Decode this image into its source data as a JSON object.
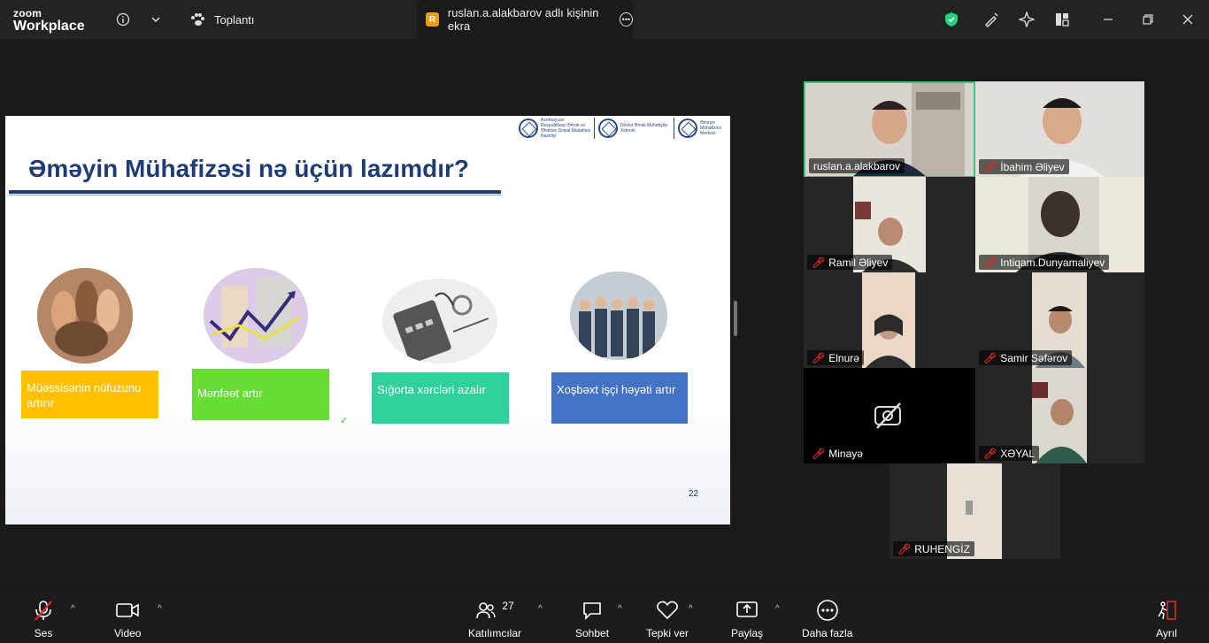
{
  "app": {
    "brand_small": "zoom",
    "brand_large": "Workplace"
  },
  "tabs": {
    "meeting": "Toplantı",
    "share": "ruslan.a.alakbarov adlı kişinin ekra",
    "share_badge": "R"
  },
  "slide": {
    "title": "Əməyin Mühafizəsi nə üçün lazımdır?",
    "logos": [
      "Azərbaycan Respublikası Əmək və Əhalinin Sosial Müdafiəsi Nazirliyi",
      "Dövlət Əmək Müfəttişliyi Xidməti",
      "Əməyin Mühafizəsi Mərkəzi"
    ],
    "cards": [
      {
        "text": "Müəssisənin nüfuzunu artırır",
        "color": "#ffc000"
      },
      {
        "text": "Mənfəət artır",
        "color": "#66dd33"
      },
      {
        "text": "Sığorta xərcləri azalır",
        "color": "#2fd09a"
      },
      {
        "text": "Xoşbəxt işçi həyəti artır",
        "color": "#4472c4"
      }
    ],
    "page_number": "22"
  },
  "participants": [
    {
      "name": "ruslan.a.alakbarov",
      "muted": false,
      "active": true
    },
    {
      "name": "İbahim Əliyev",
      "muted": true
    },
    {
      "name": "Ramil Əliyev",
      "muted": true
    },
    {
      "name": "Intiqam.Dunyamaliyev",
      "muted": true
    },
    {
      "name": "Elnurə",
      "muted": true
    },
    {
      "name": "Samir Səfərov",
      "muted": true
    },
    {
      "name": "Minayə",
      "muted": true,
      "video_off": true
    },
    {
      "name": "XƏYAL",
      "muted": true
    },
    {
      "name": "RUHENGİZ",
      "muted": true
    }
  ],
  "toolbar": {
    "audio": "Ses",
    "video": "Video",
    "participants": "Katılımcılar",
    "participants_count": "27",
    "chat": "Sohbet",
    "react": "Tepki ver",
    "share": "Paylaş",
    "more": "Daha fazla",
    "leave": "Ayrıl"
  },
  "colors": {
    "accent_green": "#26d07c",
    "muted_red": "#e02828",
    "slide_title": "#1f3d74"
  }
}
